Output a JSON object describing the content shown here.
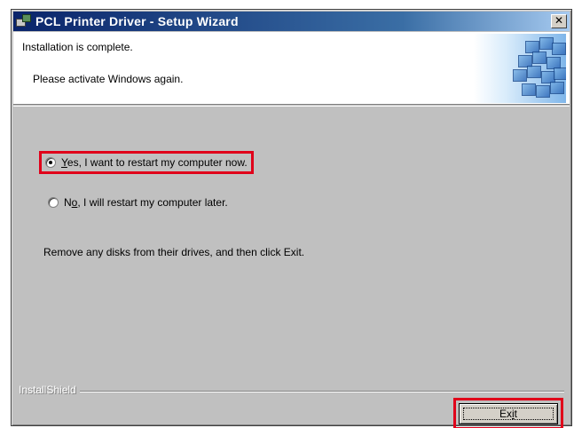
{
  "window": {
    "title": "PCL Printer Driver - Setup Wizard",
    "close_glyph": "✕"
  },
  "header": {
    "line1": "Installation is complete.",
    "line2": "Please activate Windows again."
  },
  "options": {
    "restart_now": {
      "accel": "Y",
      "rest": "es, I want to restart my computer now.",
      "checked": true
    },
    "restart_later": {
      "before": "N",
      "accel": "o",
      "rest": ", I will restart my computer later.",
      "checked": false
    }
  },
  "instruction": "Remove any disks from their drives, and then click Exit.",
  "footer": {
    "brand": "InstallShield",
    "exit_before": "Ex",
    "exit_accel": "i",
    "exit_after": "t"
  },
  "colors": {
    "highlight": "#e0001a",
    "titlebar_start": "#0a246a",
    "titlebar_end": "#a6caf0"
  }
}
